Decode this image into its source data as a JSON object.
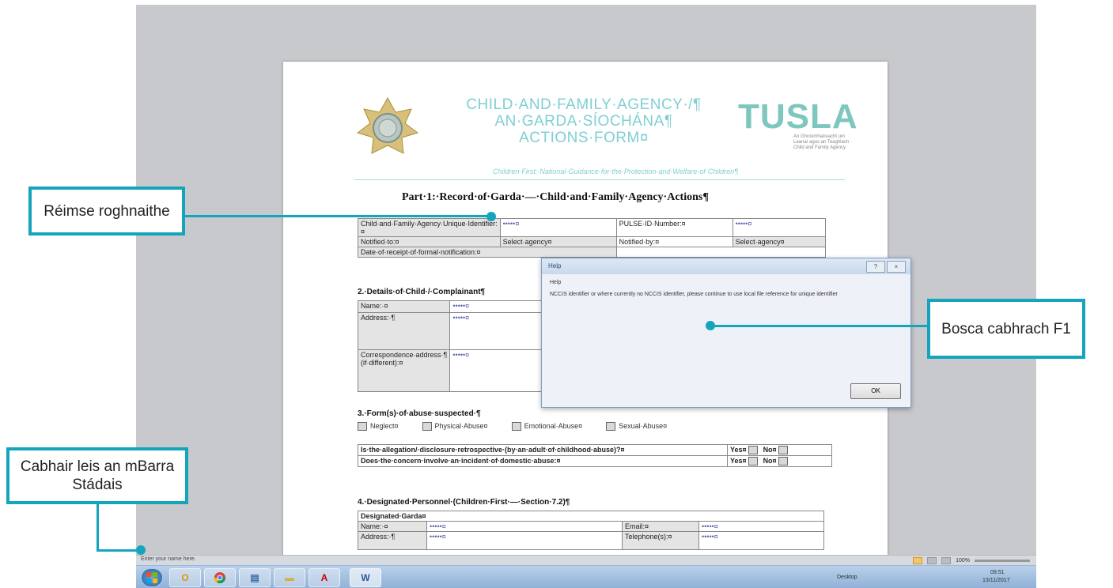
{
  "callouts": {
    "selected_field": "Réimse roghnaithe",
    "help_box": "Bosca cabhrach F1",
    "status_bar": "Cabhair leis an mBarra Stádais"
  },
  "document": {
    "header": {
      "title_line1": "CHILD·AND·FAMILY·AGENCY·/¶",
      "title_line2": "AN·GARDA·SÍOCHÁNA¶",
      "title_line3": "ACTIONS·FORM¤",
      "subtitle": "Children·First:·National·Guidance·for·the·Protection·and·Welfare·of·Children¶",
      "tusla_logo": "TUSLA",
      "tusla_sub": "An Ghníomhaireacht um Leanaí agus an Teaghlach · Child and Family Agency"
    },
    "part_title": "Part·1:·Record·of·Garda·—·Child·and·Family·Agency·Actions¶",
    "section1": {
      "uid_label": "Child·and·Family·Agency·Unique·Identifier:¤",
      "uid_value": "•••••¤",
      "pulse_label": "PULSE·ID·Number:¤",
      "pulse_value": "•••••¤",
      "notified_to_label": "Notified·to:¤",
      "notified_to_value": "Select·agency¤",
      "notified_by_label": "Notified·by:¤",
      "notified_by_value": "Select·agency¤",
      "date_label": "Date·of·receipt·of·formal·notification:¤"
    },
    "section2": {
      "heading": "2.·Details·of·Child·/·Complainant¶",
      "name_label": "Name:·¤",
      "name_value": "•••••¤",
      "address_label": "Address:·¶",
      "address_value": "•••••¤",
      "corr_label": "Correspondence·address·¶ (if·different):¤",
      "corr_value": "•••••¤"
    },
    "section3": {
      "heading": "3.·Form(s)·of·abuse·suspected·¶",
      "options": [
        "Neglect¤",
        "Physical·Abuse¤",
        "Emotional·Abuse¤",
        "Sexual·Abuse¤"
      ],
      "q1": "Is·the·allegation/·disclosure·retrospective·(by·an·adult·of·childhood·abuse)?¤",
      "q2": "Does·the·concern·involve·an·incident·of·domestic·abuse:¤",
      "yes": "Yes¤",
      "no": "No¤"
    },
    "section4": {
      "heading": "4.·Designated·Personnel·(Children·First·—·Section·7.2)¶",
      "designated": "Designated·Garda¤",
      "name_label": "Name:·¤",
      "name_value": "•••••¤",
      "email_label": "Email:¤",
      "email_value": "•••••¤",
      "address_label": "Address:·¶",
      "address_value": "•••••¤",
      "tel_label": "Telephone(s):¤",
      "tel_value": "•••••¤"
    }
  },
  "dialog": {
    "title": "Help",
    "heading": "Help",
    "body": "NCCIS identifier or where currently no NCCIS identifier, please continue to use local file reference for unique identifier",
    "ok_label": "OK"
  },
  "statusbar": {
    "text": "Enter your name here.",
    "zoom": "100%"
  },
  "taskbar": {
    "apps": [
      "start",
      "outlook",
      "chrome",
      "explorer",
      "folder",
      "acrobat",
      "word"
    ],
    "tray_desktop": "Desktop",
    "time": "09:51",
    "date": "13/11/2017"
  },
  "colors": {
    "callout": "#14a5bd",
    "title_teal": "#7fcfd2"
  }
}
